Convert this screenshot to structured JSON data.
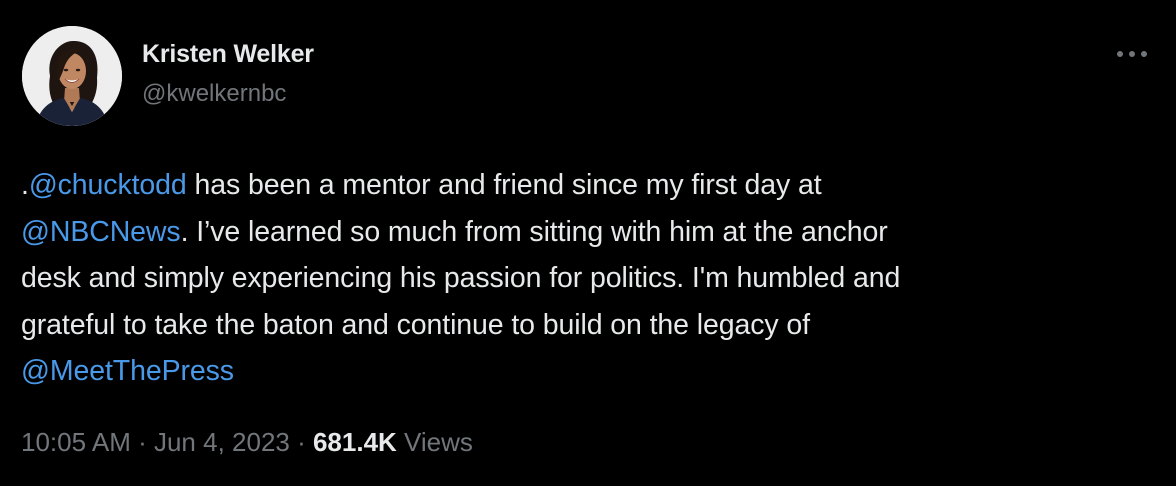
{
  "author": {
    "name": "Kristen Welker",
    "handle": "@kwelkernbc"
  },
  "tweet": {
    "line1": {
      "prefix": ".",
      "mention": "@chucktodd",
      "text": " has been a mentor and friend since my first day at"
    },
    "line2": {
      "mention": "@NBCNews",
      "text": ". I’ve learned so much from sitting with him at the anchor"
    },
    "line3": "desk and simply experiencing his passion for politics. I'm humbled and",
    "line4": "grateful to take the baton and continue to build on the legacy of",
    "line5": {
      "mention": "@MeetThePress"
    }
  },
  "meta": {
    "time": "10:05 AM",
    "separator": " · ",
    "date": "Jun 4, 2023",
    "views_count": "681.4K",
    "views_label": " Views"
  },
  "colors": {
    "background": "#000000",
    "text": "#e7e9ea",
    "secondary": "#71767b",
    "link": "#4a99e9"
  },
  "icons": {
    "more": "more-horizontal-icon",
    "avatar": "profile-photo"
  }
}
